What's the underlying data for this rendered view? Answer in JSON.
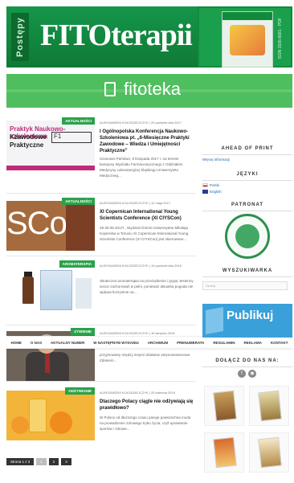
{
  "header": {
    "badge": "Postępy",
    "title": "FITOterapii",
    "side_text": "ISSN 1506-8681 · PDF"
  },
  "banner": {
    "text": "fitoteka"
  },
  "articles": [
    {
      "category": "AKTUALNOŚCI",
      "meta": "ALEKSANDRA KOŁODZIEJCZYK | 20 października 2017",
      "title": "I Ogólnopolska Konferencja Naukowo-Szkoleniowa pt. „6-Miesięczne Praktyki Zawodowe – Wiedza i Umiejętności Praktyczne”",
      "excerpt": "Szanowni Państwo, 8 listopada 2017 r. na terenie kampusu Wydziału Farmaceutycznego z Oddziałem Medycyny Laboratoryjnej Śląskiego Uniwersytetu Medyczneg...",
      "thumb_lines": [
        "Praktyk Naukowo-szkoleniowa",
        "Kzawodowe",
        "Praktyczne"
      ]
    },
    {
      "category": "AKTUALNOŚCI",
      "meta": "ALEKSANDRA KOŁODZIEJCZYK | 12 maja 2017",
      "title": "XI Copernican International Young Scientists Conference (XI CIYSCon)",
      "excerpt": "28-30.06.2017r., Wydział Chemii Uniwersytetu Mikołaja Kopernika w Toruniu XI Copernican International Young Scientists Conference (XI CIYSCon) jest skierowane...",
      "thumb_text": "SCon"
    },
    {
      "category": "AROMATERAPIA",
      "meta": "ALEKSANDRA KOŁODZIEJCZYK | 19 października 2016",
      "title": "",
      "excerpt": "Skuteczna aromaterapia na przeziębienie i grypę Jesienny sezon zachorowań w pełni, ponieważ aktualna pogoda nie wpływa korzystnie na..."
    },
    {
      "category": "ZYWIENIE",
      "meta": "ALEKSANDRA KOŁODZIEJCZYK | 19 sierpnia 2016",
      "title": "",
      "excerpt": "przyjmowany między innymi działanie antynowotworowe. Zdaniem..."
    },
    {
      "category": "ODŻYWIANIE",
      "meta": "ALEKSANDRA KOŁODZIEJCZYK | 20 kwietnia 2016",
      "title": "Dlaczego Polacy ciągle nie odżywiają się prawidłowo?",
      "excerpt": "W Polsce od dłuższego czasu panuje powszechna moda na prowadzenie zdrowego trybu życia, czyli uprawianie sportów i zdrowe..."
    }
  ],
  "nav": [
    "HOME",
    "O NAS",
    "AKTUALNY NUMER",
    "W NASTĘPNYM WYDANIU",
    "ARCHIWUM",
    "PRENUMERATA",
    "REGULAMIN",
    "REKLAMA",
    "KONTAKT"
  ],
  "pager": {
    "label": "Strona 1 z 3",
    "pages": [
      "1",
      "2",
      "3"
    ]
  },
  "sidebar": {
    "ahead_title": "AHEAD OF PRINT",
    "ahead_link": "Więcej informacji",
    "lang_title": "JĘZYKI",
    "lang_pl": "Polski",
    "lang_en": "English",
    "patronat_title": "PATRONAT",
    "search_title": "WYSZUKIWARKA",
    "search_placeholder": "Szukaj",
    "promo_text": "Publikuj",
    "follow_title": "DOŁĄCZ DO NAS NA:",
    "social": [
      "f",
      "rss"
    ]
  },
  "colors": {
    "brand_green": "#128a3c",
    "banner_green": "#4fbe5e",
    "category_green": "#2aa24a"
  }
}
